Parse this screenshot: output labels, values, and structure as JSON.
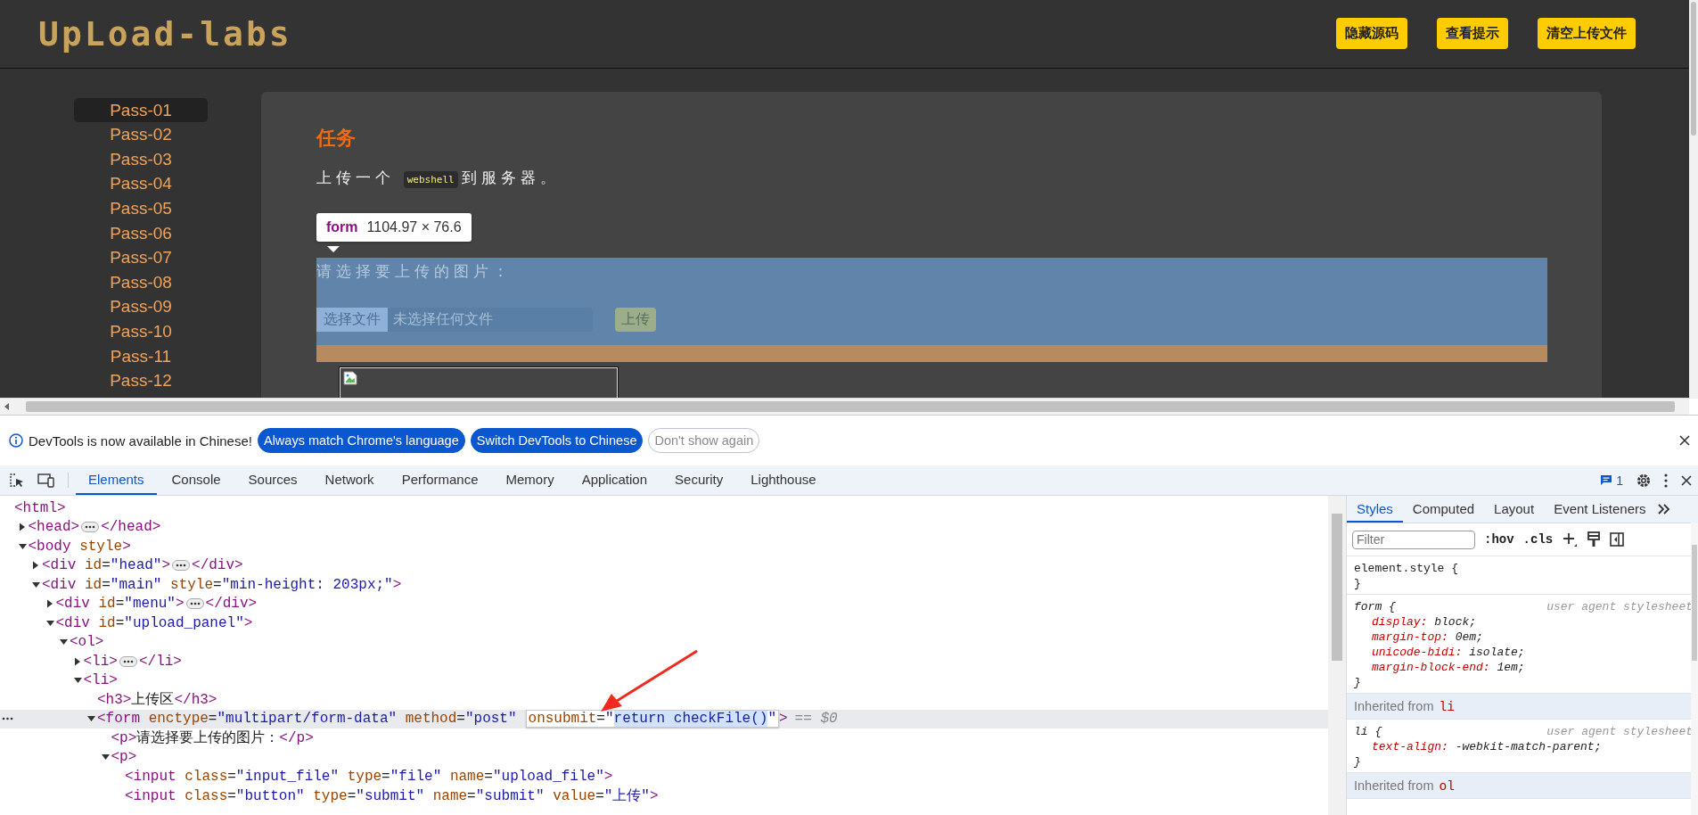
{
  "header": {
    "logo": "UpLoad-labs",
    "buttons": [
      "隐藏源码",
      "查看提示",
      "清空上传文件"
    ]
  },
  "menu": [
    {
      "label": "Pass-01",
      "selected": true
    },
    {
      "label": "Pass-02",
      "selected": false
    },
    {
      "label": "Pass-03",
      "selected": false
    },
    {
      "label": "Pass-04",
      "selected": false
    },
    {
      "label": "Pass-05",
      "selected": false
    },
    {
      "label": "Pass-06",
      "selected": false
    },
    {
      "label": "Pass-07",
      "selected": false
    },
    {
      "label": "Pass-08",
      "selected": false
    },
    {
      "label": "Pass-09",
      "selected": false
    },
    {
      "label": "Pass-10",
      "selected": false
    },
    {
      "label": "Pass-11",
      "selected": false
    },
    {
      "label": "Pass-12",
      "selected": false
    }
  ],
  "task": {
    "title": "任务",
    "before": "上传一个",
    "code": "webshell",
    "after": "到服务器。"
  },
  "inspector_tooltip": {
    "tag": "form",
    "size": "1104.97 × 76.6"
  },
  "upload_form": {
    "prompt": "请选择要上传的图片：",
    "file_button": "选择文件",
    "file_status": "未选择任何文件",
    "submit": "上传"
  },
  "devtools": {
    "infobar": {
      "message": "DevTools is now available in Chinese!",
      "buttons": [
        {
          "label": "Always match Chrome's language",
          "kind": "primary"
        },
        {
          "label": "Switch DevTools to Chinese",
          "kind": "primary"
        },
        {
          "label": "Don't show again",
          "kind": "outline"
        }
      ]
    },
    "tabs": [
      {
        "label": "Elements",
        "selected": true
      },
      {
        "label": "Console",
        "selected": false
      },
      {
        "label": "Sources",
        "selected": false
      },
      {
        "label": "Network",
        "selected": false
      },
      {
        "label": "Performance",
        "selected": false
      },
      {
        "label": "Memory",
        "selected": false
      },
      {
        "label": "Application",
        "selected": false
      },
      {
        "label": "Security",
        "selected": false
      },
      {
        "label": "Lighthouse",
        "selected": false
      }
    ],
    "issues_count": "1",
    "dom_tree": [
      {
        "text": "<html>",
        "selected": false,
        "children": [
          {
            "text": "<head>",
            "close": "</head>",
            "expanded": false,
            "selected": false
          },
          {
            "text": "<body style>",
            "expanded": true,
            "selected": false,
            "children": [
              {
                "text": "<div id=\"head\">",
                "close": "</div>",
                "expanded": false,
                "selected": false
              },
              {
                "text": "<div id=\"main\" style=\"min-height: 203px;\">",
                "expanded": true,
                "selected": false,
                "children": [
                  {
                    "text": "<div id=\"menu\">",
                    "close": "</div>",
                    "expanded": false,
                    "selected": false
                  },
                  {
                    "text": "<div id=\"upload_panel\">",
                    "expanded": true,
                    "selected": false,
                    "children": [
                      {
                        "text": "<ol>",
                        "expanded": true,
                        "selected": false,
                        "children": [
                          {
                            "text": "<li>",
                            "close": "</li>",
                            "expanded": false,
                            "selected": false
                          },
                          {
                            "text": "<li>",
                            "expanded": true,
                            "selected": false,
                            "children": [
                              {
                                "text": "<h3>上传区</h3>",
                                "selected": false
                              },
                              {
                                "text": "<form enctype=\"multipart/form-data\" method=\"post\"",
                                "editor": "onsubmit=\"return checkFile()\"",
                                "suffix": ">",
                                "hint": "== $0",
                                "expanded": true,
                                "selected": true,
                                "children": [
                                  {
                                    "text": "<p>请选择要上传的图片：</p>",
                                    "selected": false
                                  },
                                  {
                                    "text": "<p>",
                                    "expanded": true,
                                    "selected": false,
                                    "children": [
                                      {
                                        "text": "<input class=\"input_file\" type=\"file\" name=\"upload_file\">",
                                        "selected": false
                                      },
                                      {
                                        "text": "<input class=\"button\" type=\"submit\" name=\"submit\" value=\"上传\">",
                                        "selected": false
                                      }
                                    ]
                                  }
                                ]
                              }
                            ]
                          }
                        ]
                      }
                    ]
                  }
                ]
              }
            ]
          }
        ]
      }
    ],
    "styles": {
      "tabs": [
        {
          "label": "Styles",
          "selected": true
        },
        {
          "label": "Computed",
          "selected": false
        },
        {
          "label": "Layout",
          "selected": false
        },
        {
          "label": "Event Listeners",
          "selected": false
        }
      ],
      "filter": {
        "placeholder": "Filter"
      },
      "toggles": [
        ":hov",
        ".cls"
      ],
      "sections": [
        {
          "kind": "rule",
          "selector": "element.style {",
          "close": "}"
        },
        {
          "kind": "rule",
          "selector": "form {",
          "origin": "user agent stylesheet",
          "close": "}",
          "declarations": [
            {
              "property": "display:",
              "value": "block;"
            },
            {
              "property": "margin-top:",
              "value": "0em;"
            },
            {
              "property": "unicode-bidi:",
              "value": "isolate;"
            },
            {
              "property": "margin-block-end:",
              "value": "1em;"
            }
          ]
        },
        {
          "kind": "inherited",
          "label": "Inherited from",
          "element": "li"
        },
        {
          "kind": "rule",
          "selector": "li {",
          "origin": "user agent stylesheet",
          "close": "}",
          "declarations": [
            {
              "property": "text-align:",
              "value": "-webkit-match-parent;"
            }
          ]
        },
        {
          "kind": "inherited",
          "label": "Inherited from",
          "element": "ol"
        }
      ]
    }
  }
}
